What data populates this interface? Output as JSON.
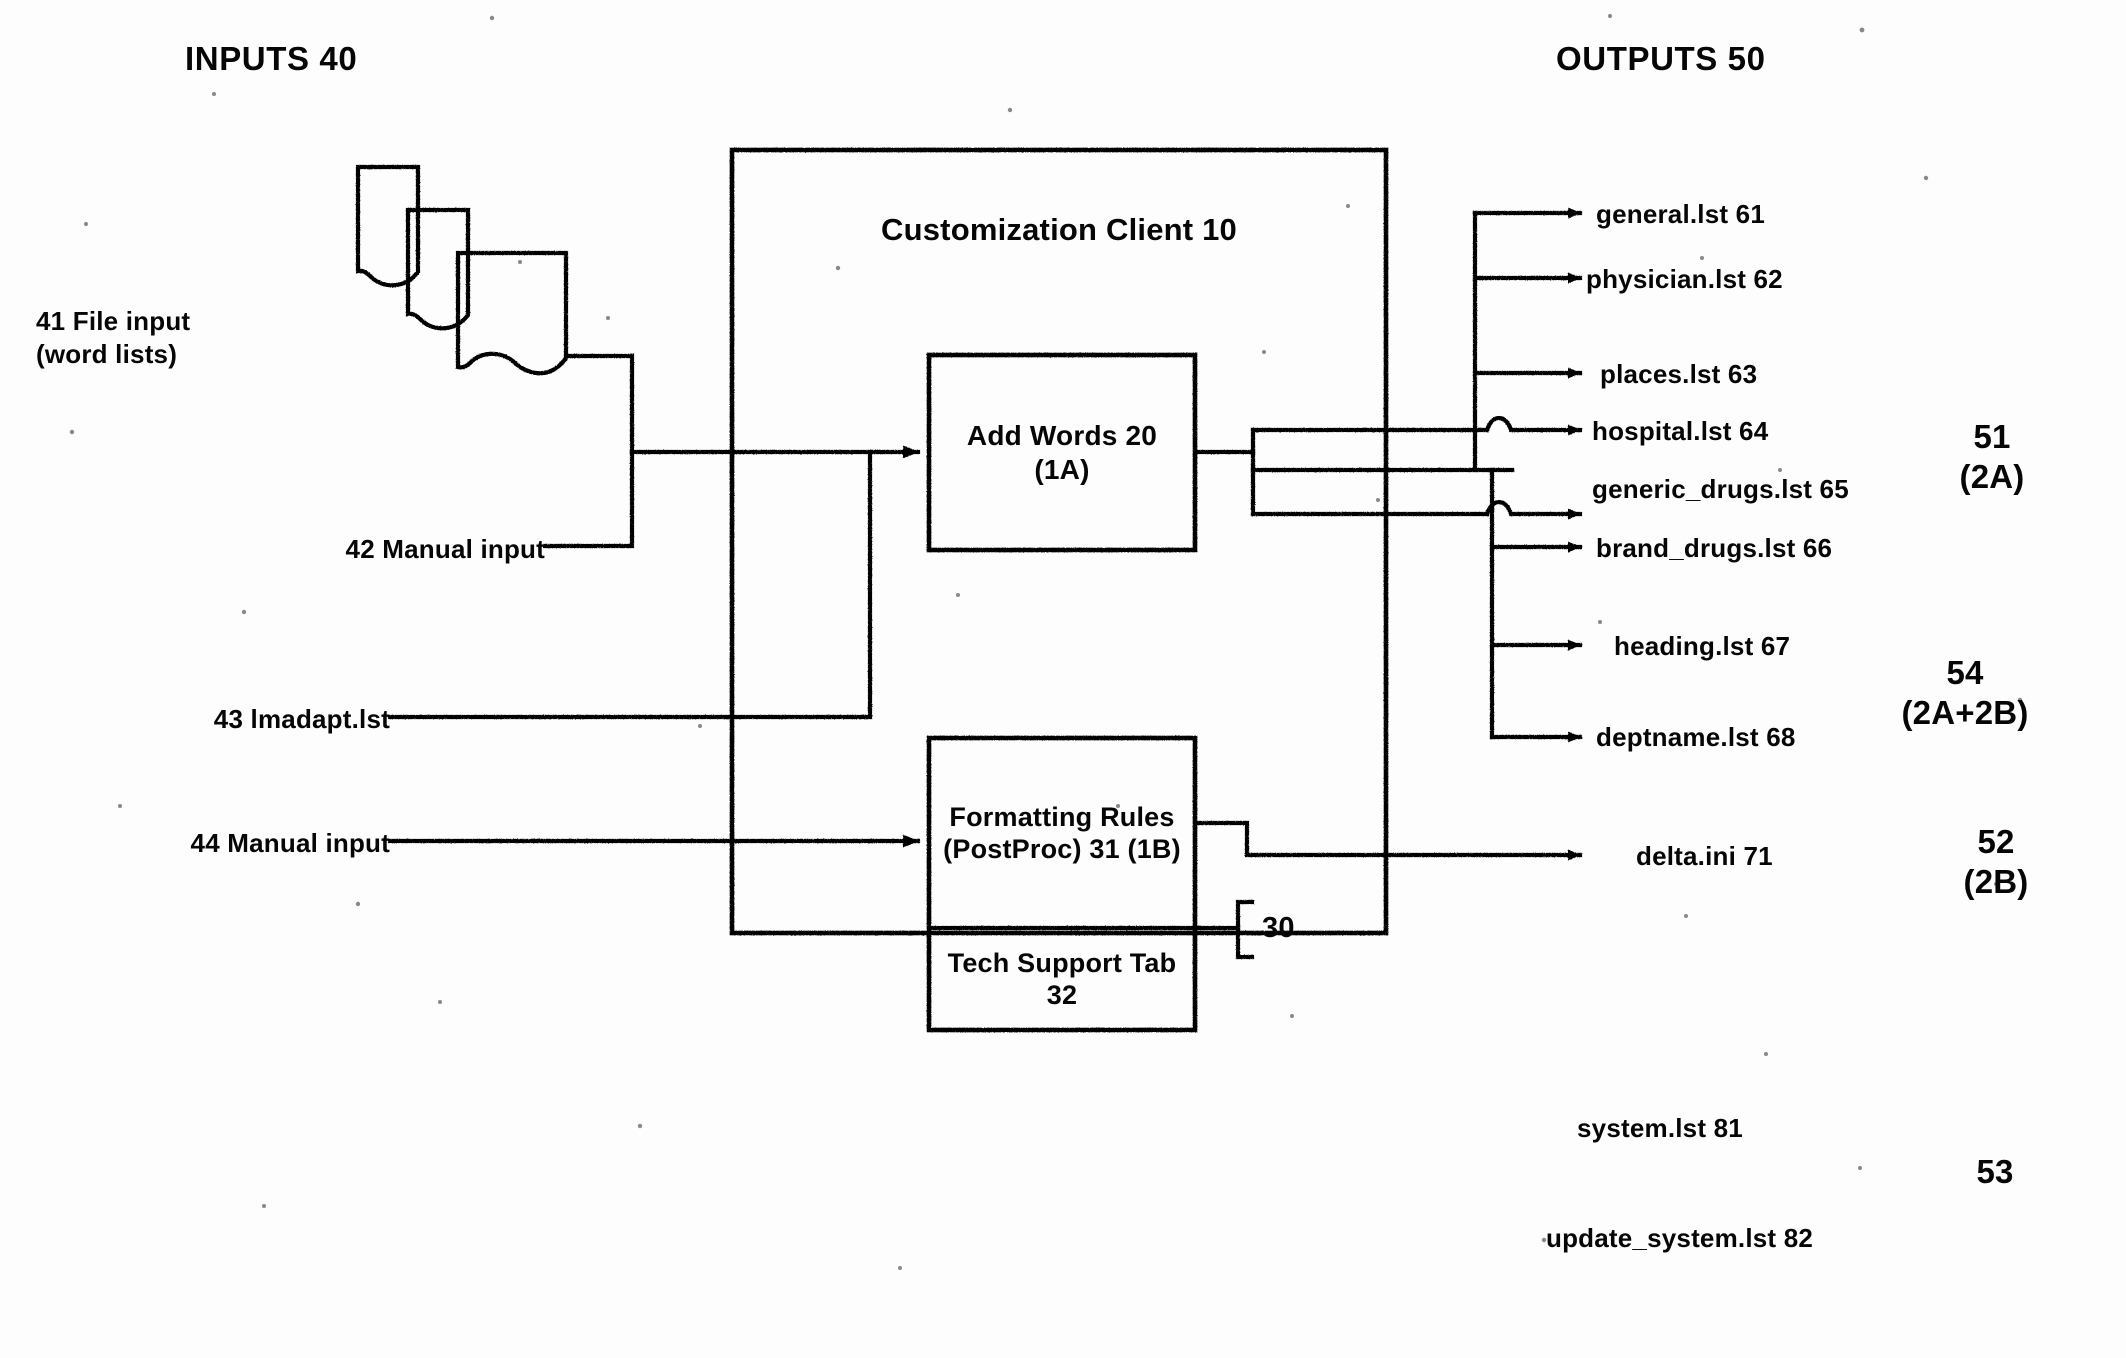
{
  "figure": {
    "headers": {
      "inputs": "INPUTS 40",
      "outputs": "OUTPUTS 50"
    },
    "main_box": {
      "title": "Customization Client 10"
    },
    "process_boxes": [
      {
        "id": "add-words",
        "line1": "Add Words 20",
        "line2": "(1A)"
      },
      {
        "id": "formatting-rules",
        "line1": "Formatting Rules",
        "line2": "(PostProc) 31 (1B)"
      },
      {
        "id": "tech-support-tab",
        "line1": "Tech Support Tab",
        "line2": "32"
      }
    ],
    "bracket_label": "30",
    "inputs": [
      {
        "id": "file-input",
        "line1": "41 File input",
        "line2": "(word lists)"
      },
      {
        "id": "manual-input-42",
        "line1": "42 Manual input",
        "line2": ""
      },
      {
        "id": "lmadapt-lst",
        "line1": "43 lmadapt.lst",
        "line2": ""
      },
      {
        "id": "manual-input-44",
        "line1": "44 Manual input",
        "line2": ""
      }
    ],
    "outputs": [
      {
        "id": "general-lst",
        "label": "general.lst 61"
      },
      {
        "id": "physician-lst",
        "label": "physician.lst 62"
      },
      {
        "id": "places-lst",
        "label": "places.lst 63"
      },
      {
        "id": "hospital-lst",
        "label": "hospital.lst 64"
      },
      {
        "id": "generic-drugs-lst",
        "label": "generic_drugs.lst 65"
      },
      {
        "id": "brand-drugs-lst",
        "label": "brand_drugs.lst  66"
      },
      {
        "id": "heading-lst",
        "label": "heading.lst 67"
      },
      {
        "id": "deptname-lst",
        "label": "deptname.lst 68"
      },
      {
        "id": "delta-ini",
        "label": "delta.ini 71"
      },
      {
        "id": "system-lst",
        "label": "system.lst 81"
      },
      {
        "id": "update-system-lst",
        "label": "update_system.lst 82"
      }
    ],
    "output_groups": [
      {
        "id": "group-51",
        "number": "51",
        "formula": "(2A)"
      },
      {
        "id": "group-54",
        "number": "54",
        "formula": "(2A+2B)"
      },
      {
        "id": "group-52",
        "number": "52",
        "formula": "(2B)"
      },
      {
        "id": "group-53",
        "number": "53",
        "formula": ""
      }
    ],
    "colors": {
      "ink": "#060606",
      "paper": "#fdfdfd"
    }
  }
}
